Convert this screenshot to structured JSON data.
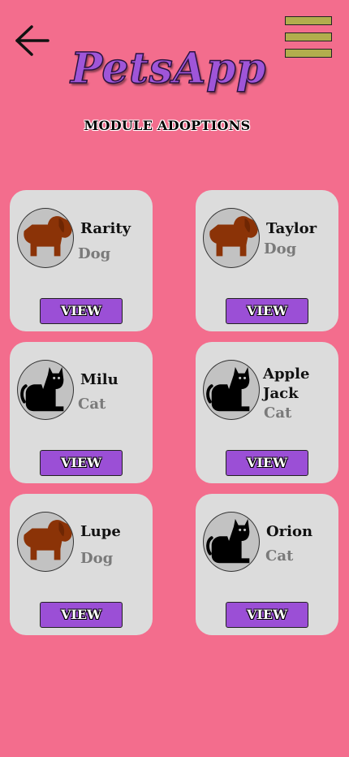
{
  "header": {
    "back_icon": "arrow-left-icon",
    "menu_icon": "hamburger-menu-icon",
    "menu_color": "#b2ad4d",
    "logo": "PetsApp",
    "subtitle": "MODULE ADOPTIONS"
  },
  "theme": {
    "background": "#f36d8d",
    "card": "#dcdcdc",
    "button": "#9b4fd6",
    "dog_color": "#8b3307",
    "cat_color": "#000000"
  },
  "pets": [
    {
      "name": "Rarity",
      "type": "Dog",
      "icon": "dog-icon",
      "button": "VIEW"
    },
    {
      "name": "Taylor",
      "type": "Dog",
      "icon": "dog-icon",
      "button": "VIEW"
    },
    {
      "name": "Milu",
      "type": "Cat",
      "icon": "cat-icon",
      "button": "VIEW"
    },
    {
      "name": "Apple Jack",
      "type": "Cat",
      "icon": "cat-icon",
      "button": "VIEW"
    },
    {
      "name": "Lupe",
      "type": "Dog",
      "icon": "dog-icon",
      "button": "VIEW"
    },
    {
      "name": "Orion",
      "type": "Cat",
      "icon": "cat-icon",
      "button": "VIEW"
    }
  ]
}
